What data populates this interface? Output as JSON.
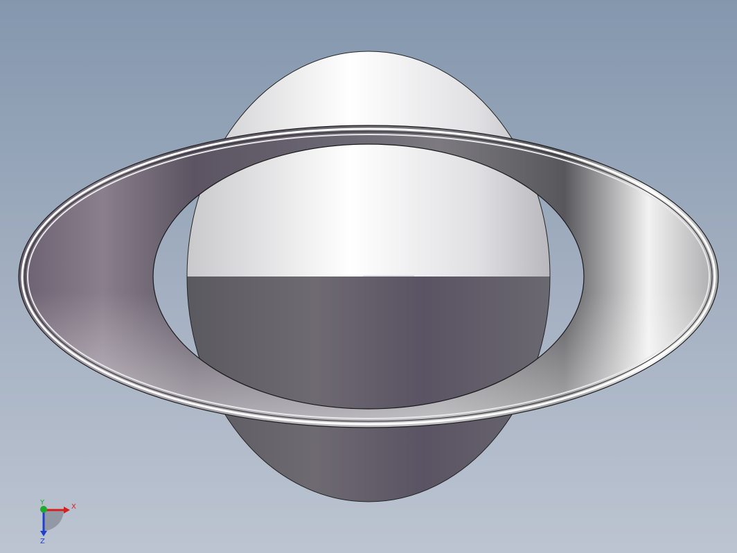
{
  "viewport": {
    "background_top": "#8497ae",
    "background_bottom": "#bcc4d1",
    "model": "dish-with-ring-flange"
  },
  "triad": {
    "x_label": "X",
    "y_label": "Y",
    "z_label": "Z",
    "x_color": "#d81e1e",
    "y_color": "#1faa2e",
    "z_color": "#1f3fd0"
  }
}
